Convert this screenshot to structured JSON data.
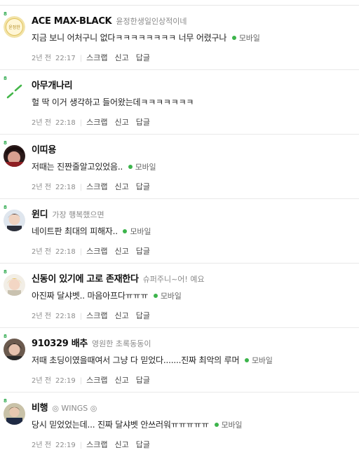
{
  "comments": [
    {
      "nick": "ACE MAX-BLACK",
      "sub": "윤정한생일인상적이네",
      "text": "지금 보니 어처구니 없다ㅋㅋㅋㅋㅋㅋㅋㅋ 너무 어렸구나",
      "mobile": "모바일",
      "date": "2년 전",
      "time": "22:17",
      "avatar_label": "윤정한",
      "level": "8"
    },
    {
      "nick": "아무개나리",
      "sub": "",
      "text": "헐 딱 이거 생각하고 들어왔는데ㅋㅋㅋㅋㅋㅋㅋ",
      "mobile": "",
      "date": "2년 전",
      "time": "22:18",
      "avatar_label": "",
      "level": "8"
    },
    {
      "nick": "이띠용",
      "sub": "",
      "text": "저때는 진짠줄알고있었음..",
      "mobile": "모바일",
      "date": "2년 전",
      "time": "22:18",
      "avatar_label": "",
      "level": "8"
    },
    {
      "nick": "윈디",
      "sub": "가장 행복했으면",
      "text": "네이트판 최대의 피해자..",
      "mobile": "모바일",
      "date": "2년 전",
      "time": "22:18",
      "avatar_label": "",
      "level": "8"
    },
    {
      "nick": "신동이 있기에 고로 존재한다",
      "sub": "슈퍼주니~어! 예요",
      "text": "아진짜 달샤벳.. 마음아프다ㅠㅠㅠ",
      "mobile": "모바일",
      "date": "2년 전",
      "time": "22:18",
      "avatar_label": "",
      "level": "8"
    },
    {
      "nick": "910329 배추",
      "sub": "영원한 초록동동이",
      "text": "저때 초딩이였을때여서 그냥 다 믿었다.......진짜 최악의 루머",
      "mobile": "모바일",
      "date": "2년 전",
      "time": "22:19",
      "avatar_label": "",
      "level": "8"
    },
    {
      "nick": "비행",
      "sub": "◎ WINGS ◎",
      "text": "당시 믿었었는데... 진짜 달샤벳 안쓰러워ㅠㅠㅠㅠㅠ",
      "mobile": "모바일",
      "date": "2년 전",
      "time": "22:19",
      "avatar_label": "",
      "level": "8"
    }
  ],
  "actions": {
    "scrap": "스크랩",
    "report": "신고",
    "reply": "답글"
  },
  "colors": {
    "mobile_dot": "#3cb44b",
    "level_badge": "#2aa84a"
  }
}
